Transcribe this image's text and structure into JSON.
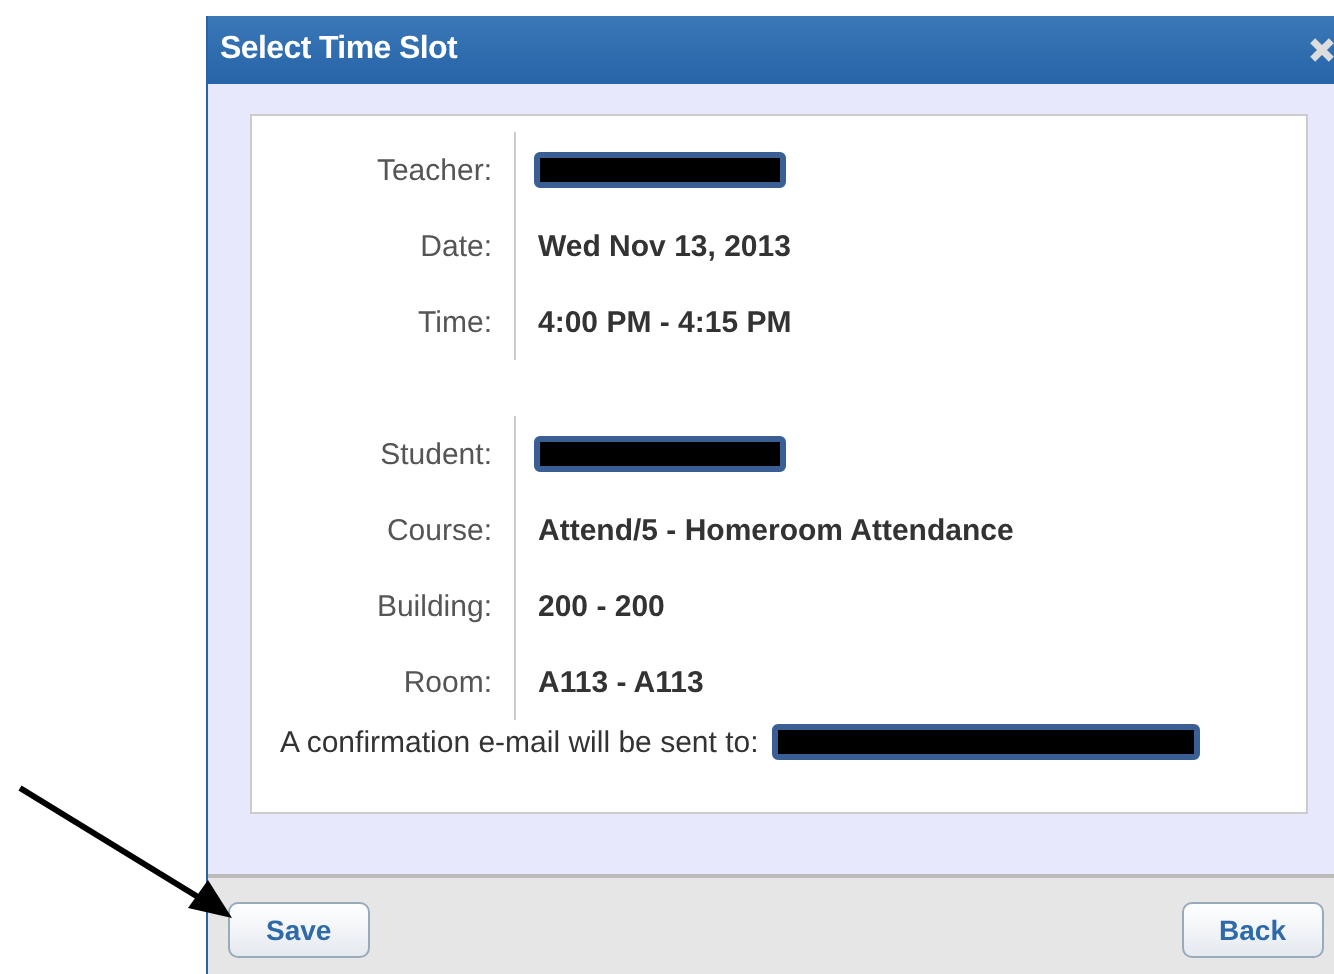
{
  "dialog": {
    "title": "Select Time Slot"
  },
  "sections": [
    {
      "fields": [
        {
          "label": "Teacher:",
          "kind": "redacted"
        },
        {
          "label": "Date:",
          "kind": "text",
          "value": "Wed Nov 13, 2013"
        },
        {
          "label": "Time:",
          "kind": "text",
          "value": "4:00 PM - 4:15 PM"
        }
      ]
    },
    {
      "fields": [
        {
          "label": "Student:",
          "kind": "redacted"
        },
        {
          "label": "Course:",
          "kind": "text",
          "value": "Attend/5 - Homeroom Attendance"
        },
        {
          "label": "Building:",
          "kind": "text",
          "value": "200 - 200"
        },
        {
          "label": "Room:",
          "kind": "text",
          "value": "A113 - A113"
        }
      ]
    }
  ],
  "confirmation": {
    "text": "A confirmation e-mail will be sent to:"
  },
  "buttons": [
    {
      "label": "Save"
    },
    {
      "label": "Back"
    }
  ]
}
